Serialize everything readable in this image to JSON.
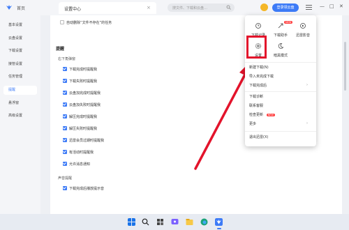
{
  "titlebar": {
    "app_title": "首页",
    "tab_label": "设置中心",
    "search_placeholder": "搜文件、下载和云盘…",
    "login_label": "登录领云盘",
    "window_controls": [
      "—",
      "□",
      "✕"
    ]
  },
  "sidebar": {
    "items": [
      {
        "label": "基本设置"
      },
      {
        "label": "云盘设置"
      },
      {
        "label": "下载设置"
      },
      {
        "label": "接管设置"
      },
      {
        "label": "任务管理"
      },
      {
        "label": "提醒"
      },
      {
        "label": "悬浮窗"
      },
      {
        "label": "高级设置"
      }
    ],
    "active_index": 5
  },
  "main": {
    "auto_delete": "自动删除“文件不存在”的任务",
    "section_title": "提醒",
    "sub_title": "右下角弹窗",
    "options": [
      {
        "label": "下载完成时提醒我",
        "checked": true
      },
      {
        "label": "下载失败时提醒我",
        "checked": true
      },
      {
        "label": "云盘加完成时提醒我",
        "checked": true
      },
      {
        "label": "云盘加失败时提醒我",
        "checked": true
      },
      {
        "label": "解压完成时提醒我",
        "checked": true
      },
      {
        "label": "解压失败时提醒我",
        "checked": true
      },
      {
        "label": "迅雷会员过期时提醒我",
        "checked": true
      },
      {
        "label": "有活动时提醒我",
        "checked": true
      },
      {
        "label": "允许消息通知",
        "checked": true
      }
    ],
    "sound_title": "声音提醒",
    "sound_option": "下载完成后播放提示音"
  },
  "dropdown": {
    "top_row1": [
      {
        "label": "下载记录",
        "icon": "history-icon"
      },
      {
        "label": "下载助手",
        "icon": "download-helper-icon"
      },
      {
        "label": "迅雷影音",
        "icon": "player-icon"
      }
    ],
    "top_row2": [
      {
        "label": "设置",
        "icon": "settings-icon"
      },
      {
        "label": "暗黑模式",
        "icon": "moon-icon"
      }
    ],
    "list1": [
      "新建下载(N)",
      "导入未完成下载",
      "下载完成后"
    ],
    "list2": [
      "下载诊断",
      "联系客服",
      "检查更新",
      "更多"
    ],
    "new_badge": "NEW",
    "list3": [
      "退出迅雷(X)"
    ]
  },
  "colors": {
    "accent": "#3d7bf7",
    "highlight": "#e3132b"
  },
  "taskbar": {
    "icons": [
      "windows-icon",
      "search-icon",
      "files-icon",
      "chat-icon",
      "explorer-icon",
      "edge-icon",
      "store-icon",
      "xunlei-icon"
    ]
  }
}
